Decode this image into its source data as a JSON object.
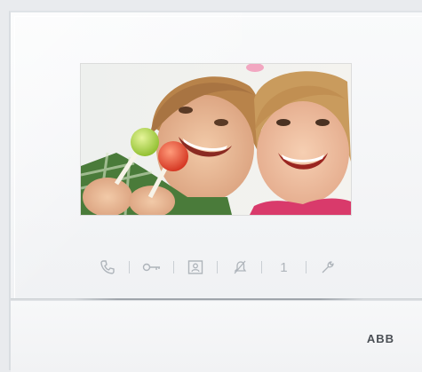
{
  "device": {
    "brand": "ABB"
  },
  "screen": {
    "content": "video-feed-image"
  },
  "controls": {
    "buttons": [
      {
        "icon": "phone-icon"
      },
      {
        "icon": "key-icon"
      },
      {
        "icon": "intercom-screen-icon"
      },
      {
        "icon": "mute-bell-icon"
      },
      {
        "icon": "one-key",
        "label": "1"
      },
      {
        "icon": "wrench-icon"
      }
    ],
    "icon_color": "#aeb4ba"
  },
  "colors": {
    "panel": "#f5f6f8",
    "icons": "#aeb4ba",
    "brand": "#4a4f55"
  }
}
